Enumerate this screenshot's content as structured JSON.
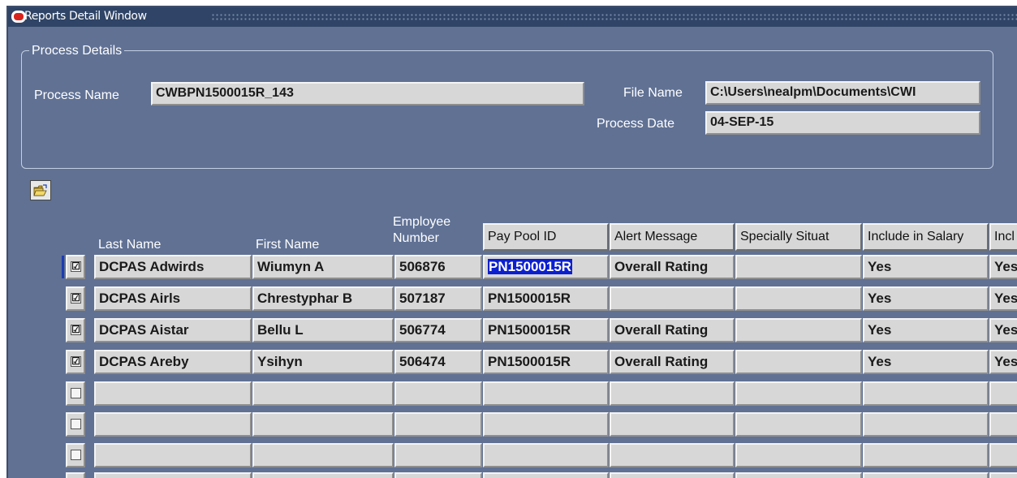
{
  "window": {
    "title": "Reports Detail Window"
  },
  "process_details": {
    "group_title": "Process Details",
    "process_name_label": "Process Name",
    "process_name": "CWBPN1500015R_143",
    "file_name_label": "File Name",
    "file_name": "C:\\Users\\nealpm\\Documents\\CWI",
    "process_date_label": "Process Date",
    "process_date": "04-SEP-15"
  },
  "toolbar": {
    "open_icon": "open-folder-icon"
  },
  "table": {
    "col_last_name": "Last Name",
    "col_first_name": "First Name",
    "col_employee_1": "Employee",
    "col_employee_2": "Number",
    "col_pay_pool": "Pay Pool ID",
    "col_alert": "Alert Message",
    "col_specially": "Specially Situat",
    "col_include_salary": "Include in Salary",
    "col_include_more": "Incl",
    "rows": [
      {
        "checked": "☑",
        "last": "DCPAS Adwirds",
        "first": "Wiumyn A",
        "emp": "506876",
        "pool": "PN1500015R",
        "alert": "Overall Rating",
        "special": "",
        "include": "Yes",
        "incl": "Yes"
      },
      {
        "checked": "☑",
        "last": "DCPAS Airls",
        "first": "Chrestyphar B",
        "emp": "507187",
        "pool": "PN1500015R",
        "alert": "",
        "special": "",
        "include": "Yes",
        "incl": "Yes"
      },
      {
        "checked": "☑",
        "last": "DCPAS Aistar",
        "first": "Bellu L",
        "emp": "506774",
        "pool": "PN1500015R",
        "alert": "Overall Rating",
        "special": "",
        "include": "Yes",
        "incl": "Yes"
      },
      {
        "checked": "☑",
        "last": "DCPAS Areby",
        "first": "Ysihyn",
        "emp": "506474",
        "pool": "PN1500015R",
        "alert": "Overall Rating",
        "special": "",
        "include": "Yes",
        "incl": "Yes"
      }
    ]
  },
  "colors": {
    "background": "#607194",
    "titlebar": "#2f4466",
    "field": "#d7d7d7",
    "highlight": "#0b1fd0"
  }
}
